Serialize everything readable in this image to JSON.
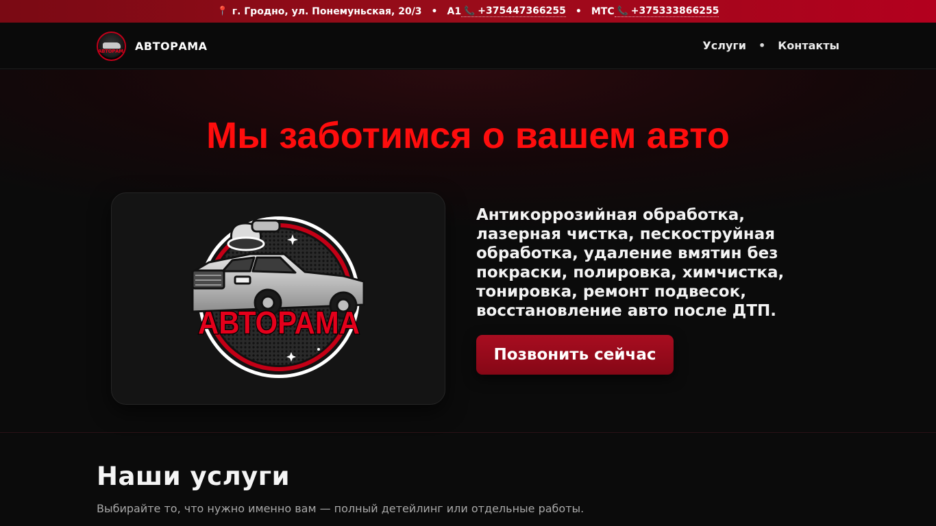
{
  "topbar": {
    "address": "г. Гродно, ул. Понемуньская, 20/3",
    "separator": "•",
    "carrier1": "A1",
    "phone1": "+375447366255",
    "carrier2": "МТС",
    "phone2": "+375333866255",
    "icons": [
      "pin-icon",
      "phone-icon"
    ]
  },
  "nav": {
    "brand": "АВТОРАМА",
    "logo_text": "АВТОРАМА",
    "links": [
      "Услуги",
      "Контакты"
    ],
    "separator": "•"
  },
  "hero": {
    "title": "Мы заботимся о вашем авто",
    "logo_text": "АВТОРАМА",
    "description": "Антикоррозийная обработка, лазерная чистка, пескоструйная обработка, удаление вмятин без покраски, полировка, химчистка, тонировка, ремонт подвесок, восстановление авто после ДТП.",
    "cta": "Позвонить сейчас"
  },
  "services": {
    "title": "Наши услуги",
    "subtitle": "Выбирайте то, что нужно именно вам — полный детейлинг или отдельные работы."
  },
  "colors": {
    "accent": "#ff0d0d",
    "topbar": "#9a0c1a",
    "button": "#a80d20",
    "background": "#0b0b0b"
  }
}
